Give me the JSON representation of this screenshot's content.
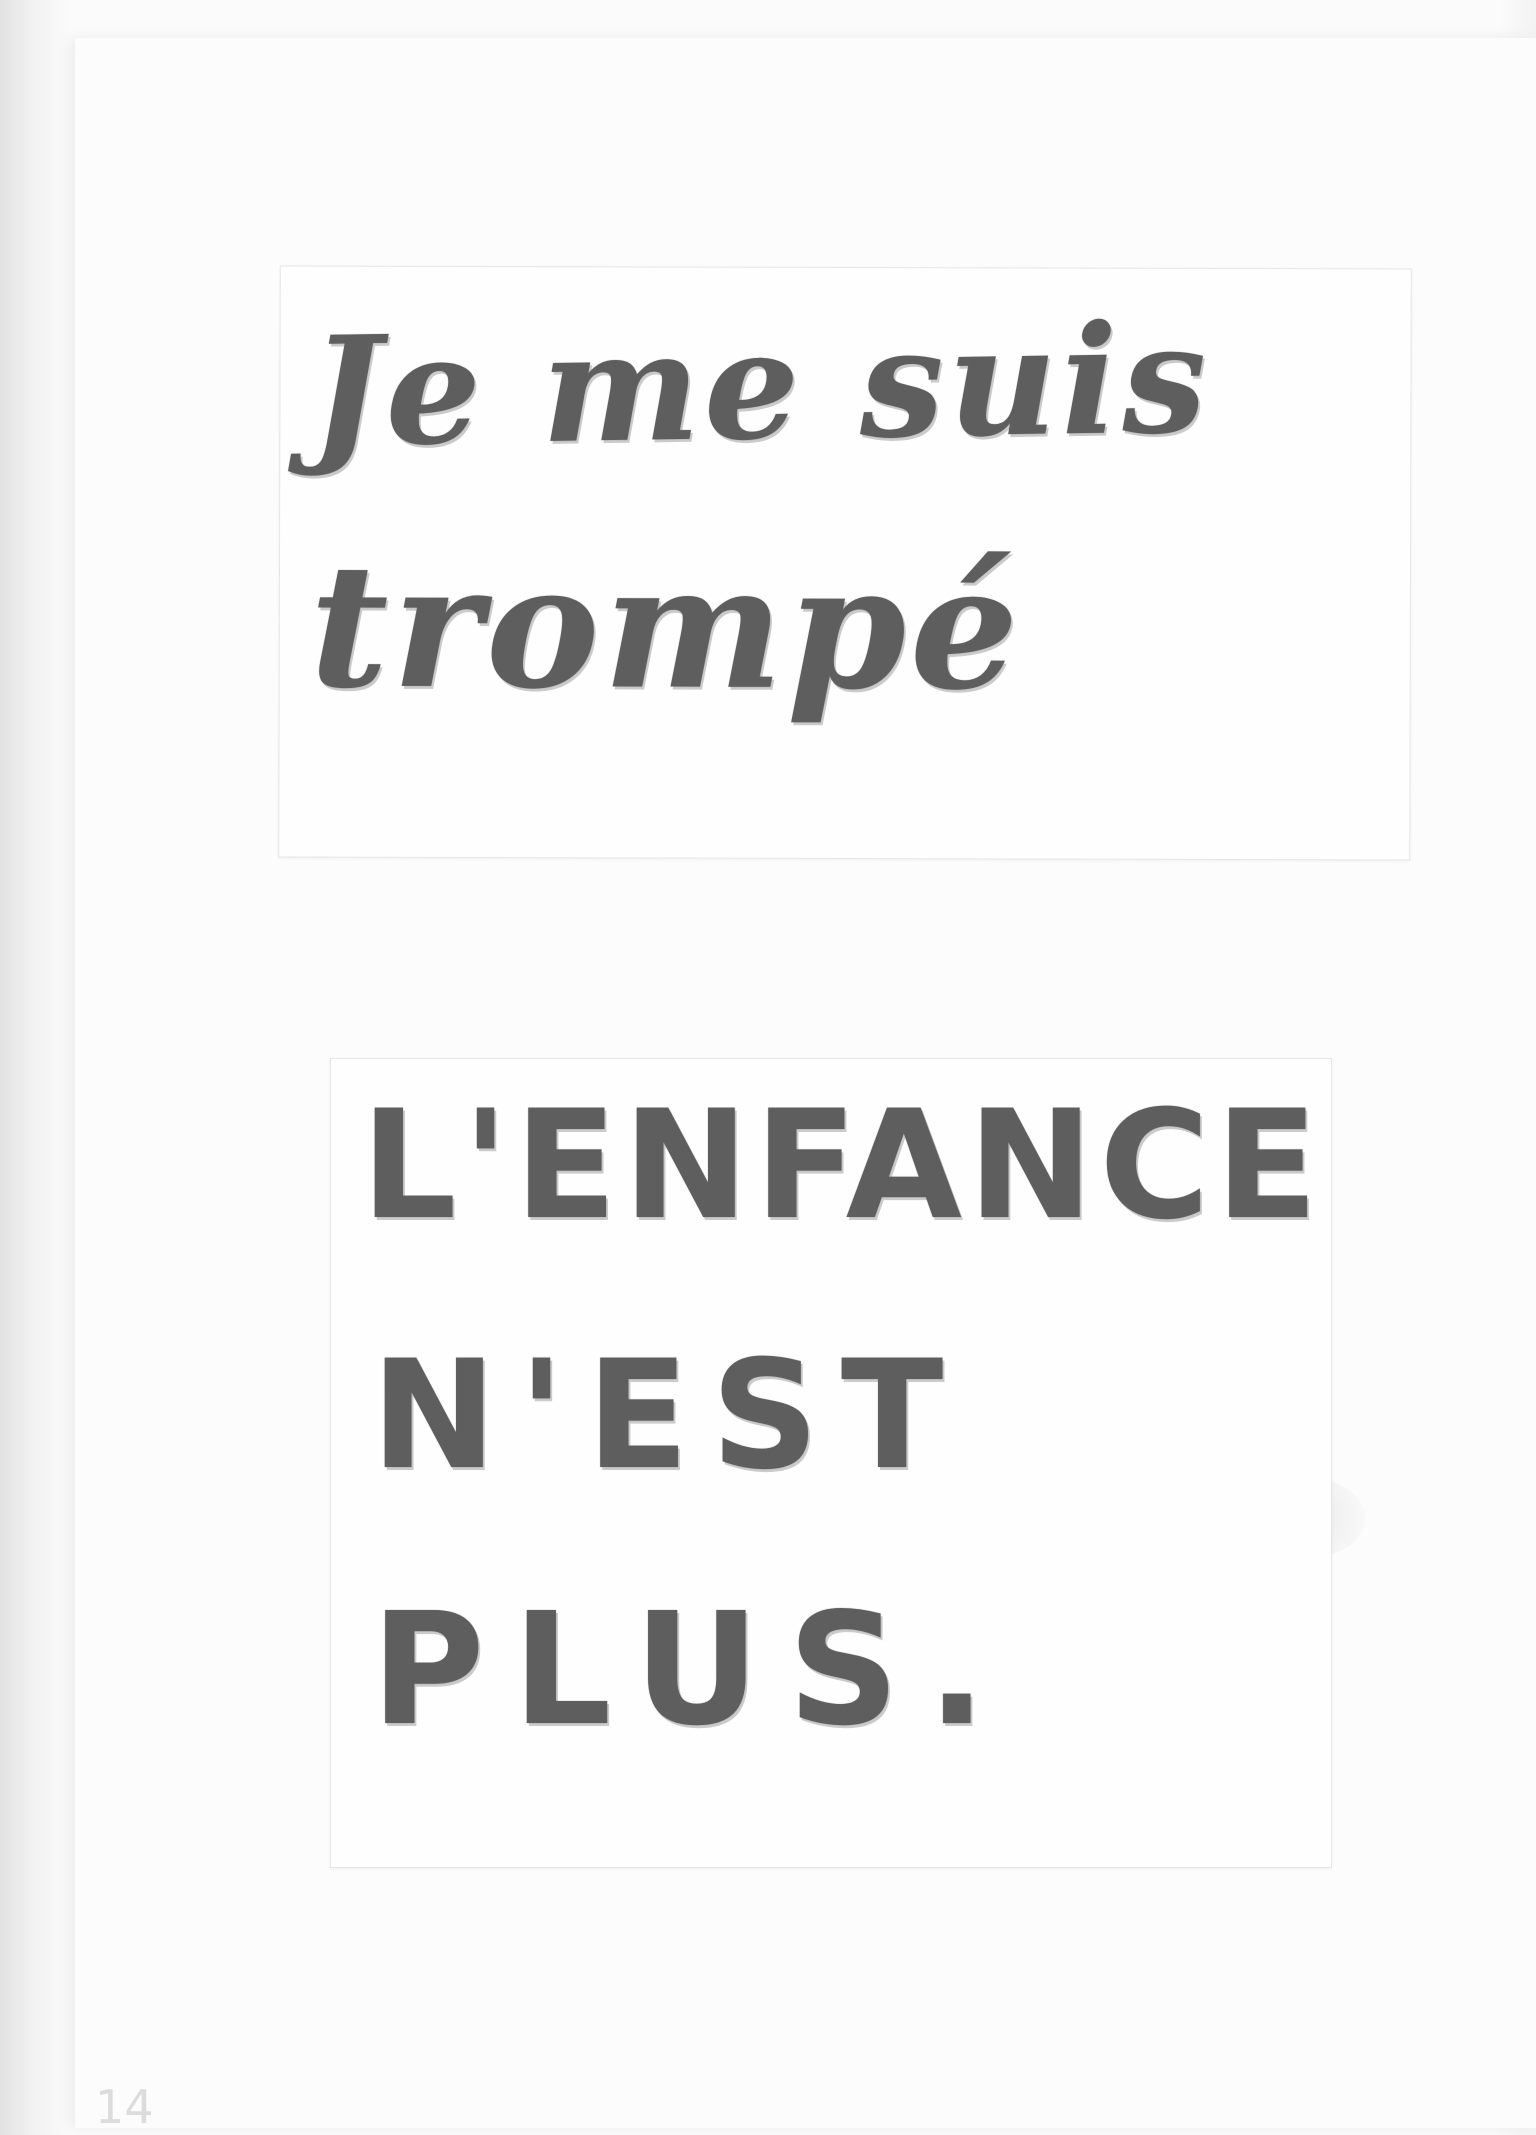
{
  "note_top": {
    "line1": "Je me suis",
    "line2": "trompé"
  },
  "note_bottom": {
    "line1": "L'ENFANCE",
    "line2": "N'EST",
    "line3": "PLUS."
  },
  "page_number": "14"
}
